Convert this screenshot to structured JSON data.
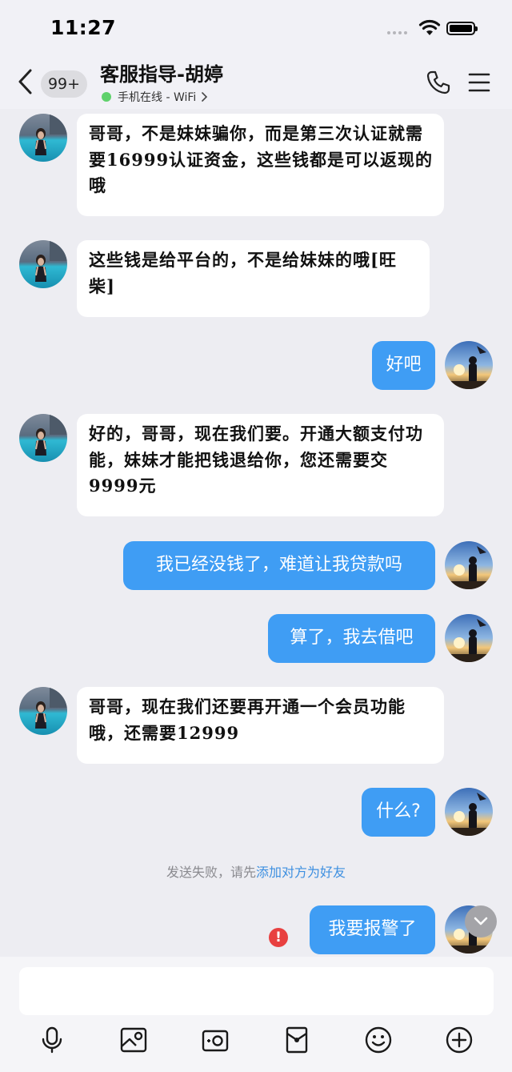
{
  "status_bar": {
    "time": "11:27"
  },
  "header": {
    "unread_badge": "99+",
    "title": "客服指导-胡婷",
    "subtitle": "手机在线 - WiFi"
  },
  "messages": [
    {
      "side": "in",
      "text": "哥哥，不是妹妹骗你，而是第三次认证就需要16999认证资金，这些钱都是可以返现的哦"
    },
    {
      "side": "in",
      "text": "这些钱是给平台的，不是给妹妹的哦[旺柴]"
    },
    {
      "side": "out",
      "text": "好吧"
    },
    {
      "side": "in",
      "text": "好的，哥哥，现在我们要。开通大额支付功能，妹妹才能把钱退给你，您还需要交9999元"
    },
    {
      "side": "out",
      "text": "我已经没钱了，难道让我贷款吗"
    },
    {
      "side": "out",
      "text": "算了，我去借吧"
    },
    {
      "side": "in",
      "text": "哥哥，现在我们还要再开通一个会员功能哦，还需要12999"
    },
    {
      "side": "out",
      "text": "什么?"
    },
    {
      "side": "out",
      "text": "我要报警了"
    }
  ],
  "system_notice": {
    "prefix": "发送失败，请先",
    "link": "添加对方为好友"
  },
  "composer": {
    "placeholder": ""
  },
  "toolbar": [
    "mic-icon",
    "image-icon",
    "camera-icon",
    "red-packet-icon",
    "emoji-icon",
    "plus-icon"
  ],
  "colors": {
    "outgoing_bubble": "#3F9DF4",
    "incoming_bubble": "#FFFFFF",
    "background": "#EDEDF2",
    "link": "#3D8FE0",
    "error": "#E84040"
  }
}
